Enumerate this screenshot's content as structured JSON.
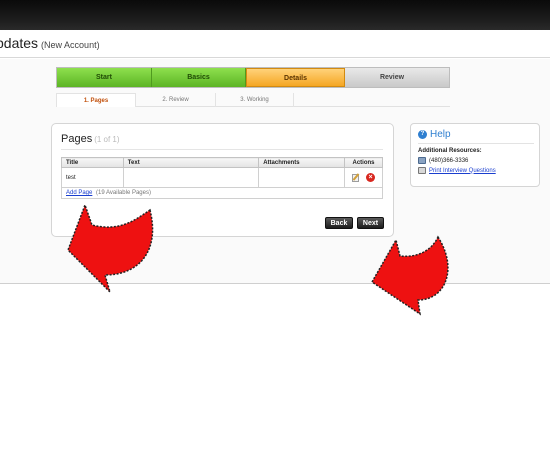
{
  "header": {
    "title": "pdates",
    "subtitle": "(New Account)"
  },
  "wizard": {
    "tabs": [
      {
        "label": "Start",
        "state": "done"
      },
      {
        "label": "Basics",
        "state": "done"
      },
      {
        "label": "Details",
        "state": "active"
      },
      {
        "label": "Review",
        "state": "todo"
      }
    ],
    "subtabs": [
      {
        "label": "1. Pages",
        "active": true
      },
      {
        "label": "2. Review",
        "active": false
      },
      {
        "label": "3. Working",
        "active": false
      }
    ]
  },
  "pages_panel": {
    "title": "Pages",
    "count": "(1 of 1)",
    "columns": [
      "Title",
      "Text",
      "Attachments",
      "Actions"
    ],
    "rows": [
      {
        "title": "test",
        "text": "",
        "attachments": ""
      }
    ],
    "add_link": "Add Page",
    "available": "(19 Available Pages)",
    "back_label": "Back",
    "next_label": "Next"
  },
  "help": {
    "title": "Help",
    "resources_label": "Additional Resources:",
    "phone": "(480)366-3336",
    "print_link": "Print Interview Questions"
  },
  "colors": {
    "done_tab": "#6cc631",
    "active_tab": "#f5a623",
    "todo_tab": "#d0d0d0",
    "annotation_arrow": "#ee1111",
    "link": "#1a3ecf"
  }
}
